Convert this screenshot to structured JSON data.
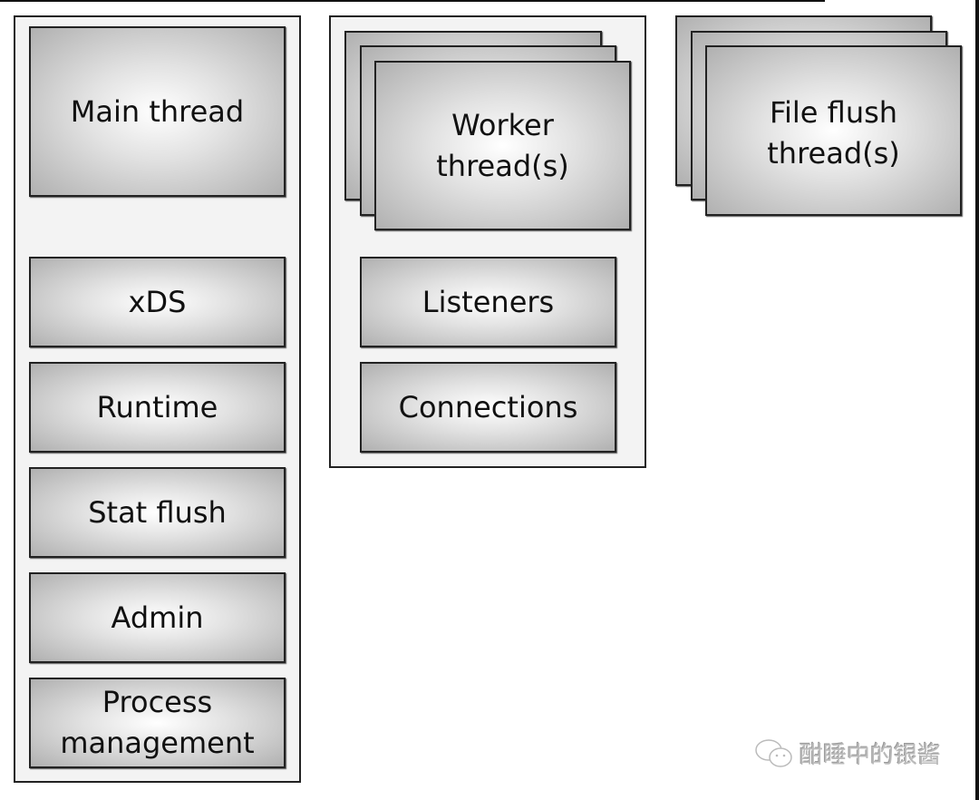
{
  "main_group": {
    "title": "Main thread",
    "items": [
      "xDS",
      "Runtime",
      "Stat flush",
      "Admin",
      "Process\nmanagement"
    ]
  },
  "worker_group": {
    "title": "Worker\nthread(s)",
    "items": [
      "Listeners",
      "Connections"
    ]
  },
  "file_flush": {
    "title": "File flush\nthread(s)"
  },
  "watermark": {
    "text": "酣睡中的银酱",
    "icon": "wechat-icon"
  }
}
